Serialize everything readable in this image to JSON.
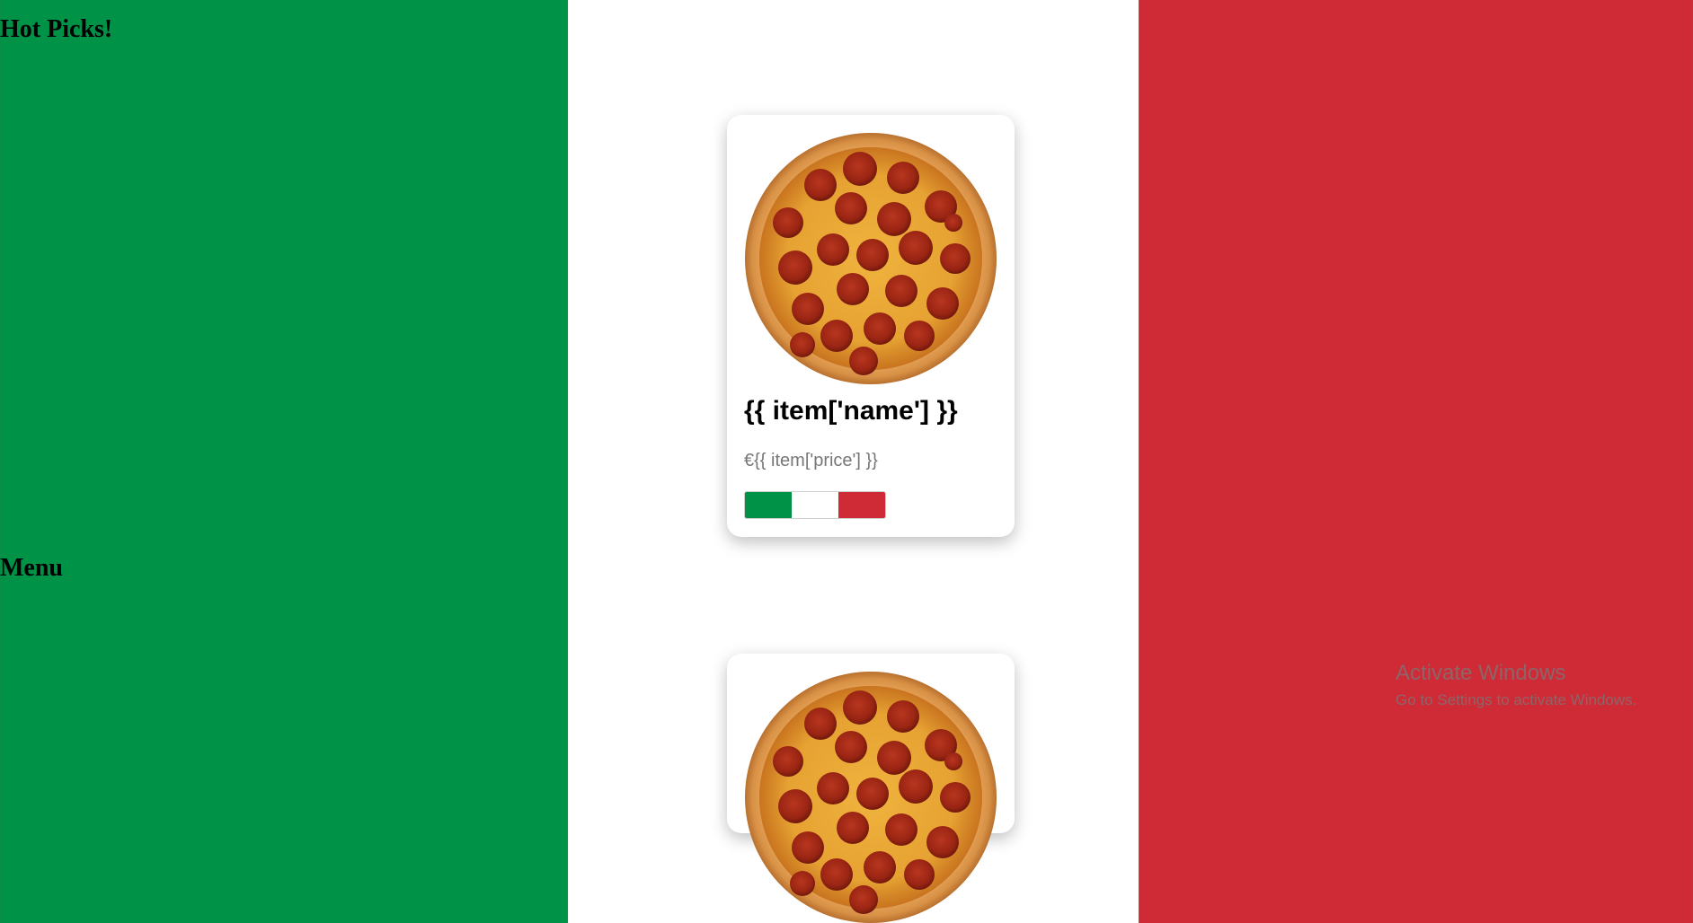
{
  "sections": {
    "hot_picks_title": "Hot Picks!",
    "menu_title": "Menu"
  },
  "cards": [
    {
      "name": "{{ item['name'] }}",
      "price": "€{{ item['price'] }}",
      "image": "pepperoni-pizza"
    },
    {
      "name": "",
      "price": "",
      "image": "pepperoni-pizza"
    }
  ],
  "colors": {
    "green": "#009246",
    "white": "#ffffff",
    "red": "#ce2b37"
  },
  "watermark": {
    "title": "Activate Windows",
    "subtitle": "Go to Settings to activate Windows."
  }
}
